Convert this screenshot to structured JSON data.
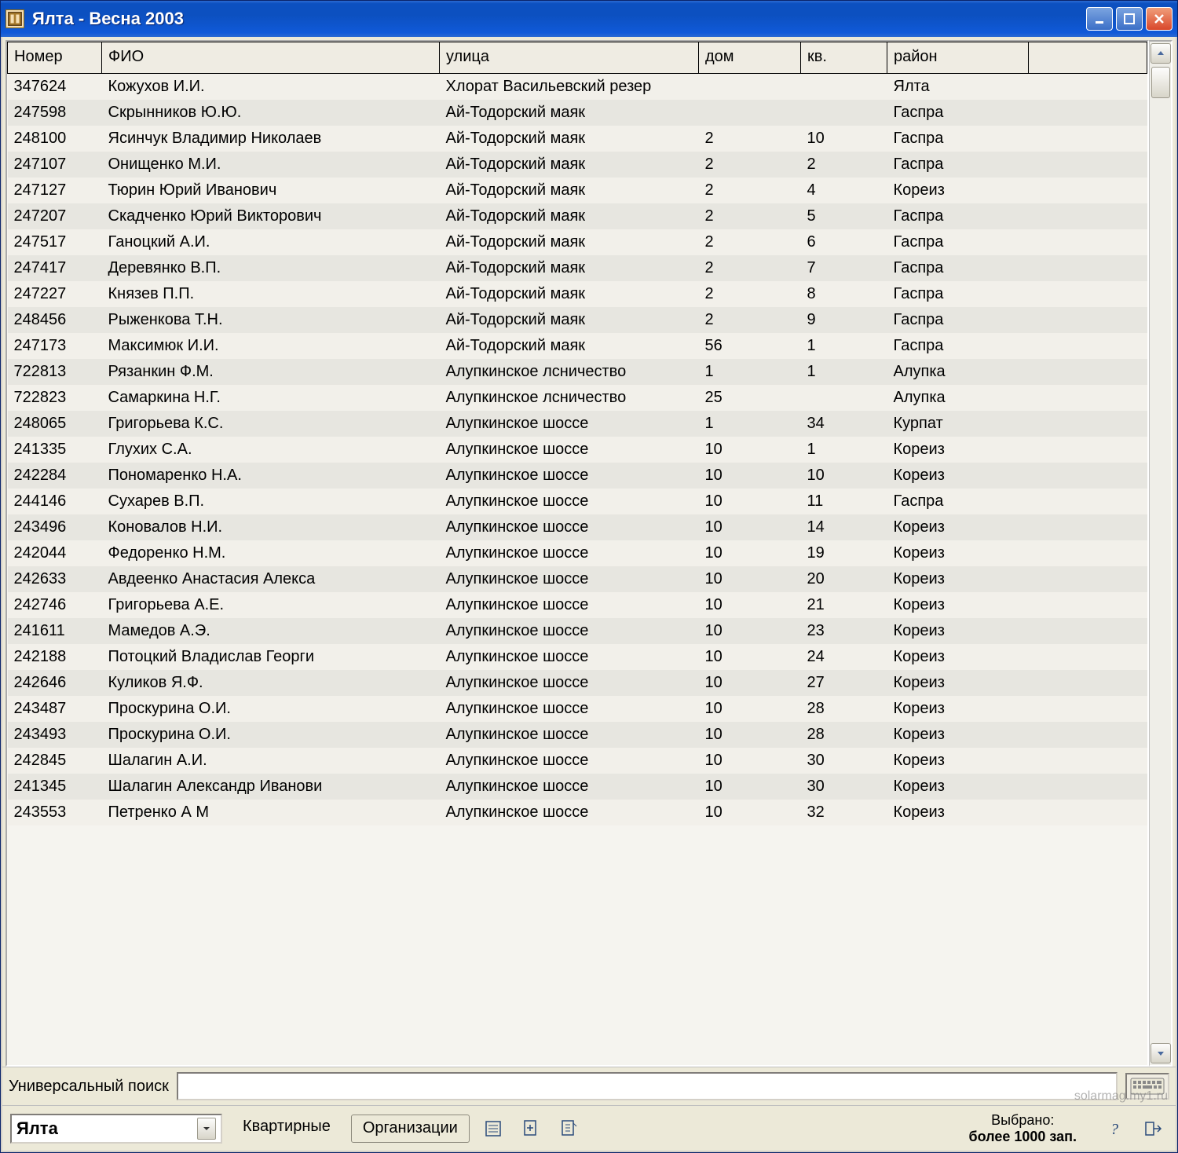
{
  "window": {
    "title": "Ялта  - Весна 2003"
  },
  "columns": {
    "num": "Номер",
    "fio": "ФИО",
    "street": "улица",
    "house": "дом",
    "flat": "кв.",
    "raion": "район"
  },
  "rows": [
    {
      "num": "347624",
      "fio": "Кожухов И.И.",
      "street": " Хлорат Васильевский резер",
      "house": "",
      "flat": "",
      "raion": "Ялта"
    },
    {
      "num": "247598",
      "fio": "Скрынников Ю.Ю.",
      "street": "Ай-Тодорский маяк",
      "house": "",
      "flat": "",
      "raion": "Гаспра"
    },
    {
      "num": "248100",
      "fio": "Ясинчук Владимир Николаев",
      "street": "Ай-Тодорский маяк",
      "house": "2",
      "flat": "10",
      "raion": "Гаспра"
    },
    {
      "num": "247107",
      "fio": "Онищенко М.И.",
      "street": "Ай-Тодорский маяк",
      "house": "2",
      "flat": "2",
      "raion": "Гаспра"
    },
    {
      "num": "247127",
      "fio": "Тюрин Юрий Иванович",
      "street": "Ай-Тодорский маяк",
      "house": "2",
      "flat": "4",
      "raion": "Кореиз"
    },
    {
      "num": "247207",
      "fio": "Скадченко Юрий Викторович",
      "street": "Ай-Тодорский маяк",
      "house": "2",
      "flat": "5",
      "raion": "Гаспра"
    },
    {
      "num": "247517",
      "fio": "Ганоцкий А.И.",
      "street": "Ай-Тодорский маяк",
      "house": "2",
      "flat": "6",
      "raion": "Гаспра"
    },
    {
      "num": "247417",
      "fio": "Деревянко В.П.",
      "street": "Ай-Тодорский маяк",
      "house": "2",
      "flat": "7",
      "raion": "Гаспра"
    },
    {
      "num": "247227",
      "fio": "Князев П.П.",
      "street": "Ай-Тодорский маяк",
      "house": "2",
      "flat": "8",
      "raion": "Гаспра"
    },
    {
      "num": "248456",
      "fio": "Рыженкова Т.Н.",
      "street": "Ай-Тодорский маяк",
      "house": "2",
      "flat": "9",
      "raion": "Гаспра"
    },
    {
      "num": "247173",
      "fio": "Максимюк И.И.",
      "street": "Ай-Тодорский маяк",
      "house": "56",
      "flat": "1",
      "raion": "Гаспра"
    },
    {
      "num": "722813",
      "fio": "Рязанкин Ф.М.",
      "street": "Алупкинское лсничество",
      "house": "1",
      "flat": "1",
      "raion": "Алупка"
    },
    {
      "num": "722823",
      "fio": "Самаркина Н.Г.",
      "street": "Алупкинское лсничество",
      "house": "25",
      "flat": "",
      "raion": "Алупка"
    },
    {
      "num": "248065",
      "fio": "Григорьева К.С.",
      "street": "Алупкинское шоссе",
      "house": "1",
      "flat": "34",
      "raion": "Курпат"
    },
    {
      "num": "241335",
      "fio": "Глухих С.А.",
      "street": "Алупкинское шоссе",
      "house": "10",
      "flat": "1",
      "raion": "Кореиз"
    },
    {
      "num": "242284",
      "fio": "Пономаренко Н.А.",
      "street": "Алупкинское шоссе",
      "house": "10",
      "flat": "10",
      "raion": "Кореиз"
    },
    {
      "num": "244146",
      "fio": "Сухарев В.П.",
      "street": "Алупкинское шоссе",
      "house": "10",
      "flat": "11",
      "raion": "Гаспра"
    },
    {
      "num": "243496",
      "fio": "Коновалов Н.И.",
      "street": "Алупкинское шоссе",
      "house": "10",
      "flat": "14",
      "raion": "Кореиз"
    },
    {
      "num": "242044",
      "fio": "Федоренко Н.М.",
      "street": "Алупкинское шоссе",
      "house": "10",
      "flat": "19",
      "raion": "Кореиз"
    },
    {
      "num": "242633",
      "fio": "Авдеенко Анастасия Алекса",
      "street": "Алупкинское шоссе",
      "house": "10",
      "flat": "20",
      "raion": "Кореиз"
    },
    {
      "num": "242746",
      "fio": "Григорьева А.Е.",
      "street": "Алупкинское шоссе",
      "house": "10",
      "flat": "21",
      "raion": "Кореиз"
    },
    {
      "num": "241611",
      "fio": "Мамедов А.Э.",
      "street": "Алупкинское шоссе",
      "house": "10",
      "flat": "23",
      "raion": "Кореиз"
    },
    {
      "num": "242188",
      "fio": "Потоцкий Владислав Георги",
      "street": "Алупкинское шоссе",
      "house": "10",
      "flat": "24",
      "raion": "Кореиз"
    },
    {
      "num": "242646",
      "fio": "Куликов Я.Ф.",
      "street": "Алупкинское шоссе",
      "house": "10",
      "flat": "27",
      "raion": "Кореиз"
    },
    {
      "num": "243487",
      "fio": "Проскурина О.И.",
      "street": "Алупкинское шоссе",
      "house": "10",
      "flat": "28",
      "raion": "Кореиз"
    },
    {
      "num": "243493",
      "fio": "Проскурина О.И.",
      "street": "Алупкинское шоссе",
      "house": "10",
      "flat": "28",
      "raion": "Кореиз"
    },
    {
      "num": "242845",
      "fio": "Шалагин А.И.",
      "street": "Алупкинское шоссе",
      "house": "10",
      "flat": "30",
      "raion": "Кореиз"
    },
    {
      "num": "241345",
      "fio": "Шалагин Александр Иванови",
      "street": "Алупкинское шоссе",
      "house": "10",
      "flat": "30",
      "raion": "Кореиз"
    },
    {
      "num": "243553",
      "fio": "Петренко А М",
      "street": "Алупкинское шоссе",
      "house": "10",
      "flat": "32",
      "raion": "Кореиз"
    }
  ],
  "search": {
    "label": "Универсальный поиск",
    "value": ""
  },
  "toolbar": {
    "combo_value": "Ялта",
    "btn_kvartirnye": "Квартирные",
    "btn_organizacii": "Организации",
    "status_label": "Выбрано:",
    "status_value": "более 1000 зап."
  },
  "watermark": "solarmag.my1.ru"
}
